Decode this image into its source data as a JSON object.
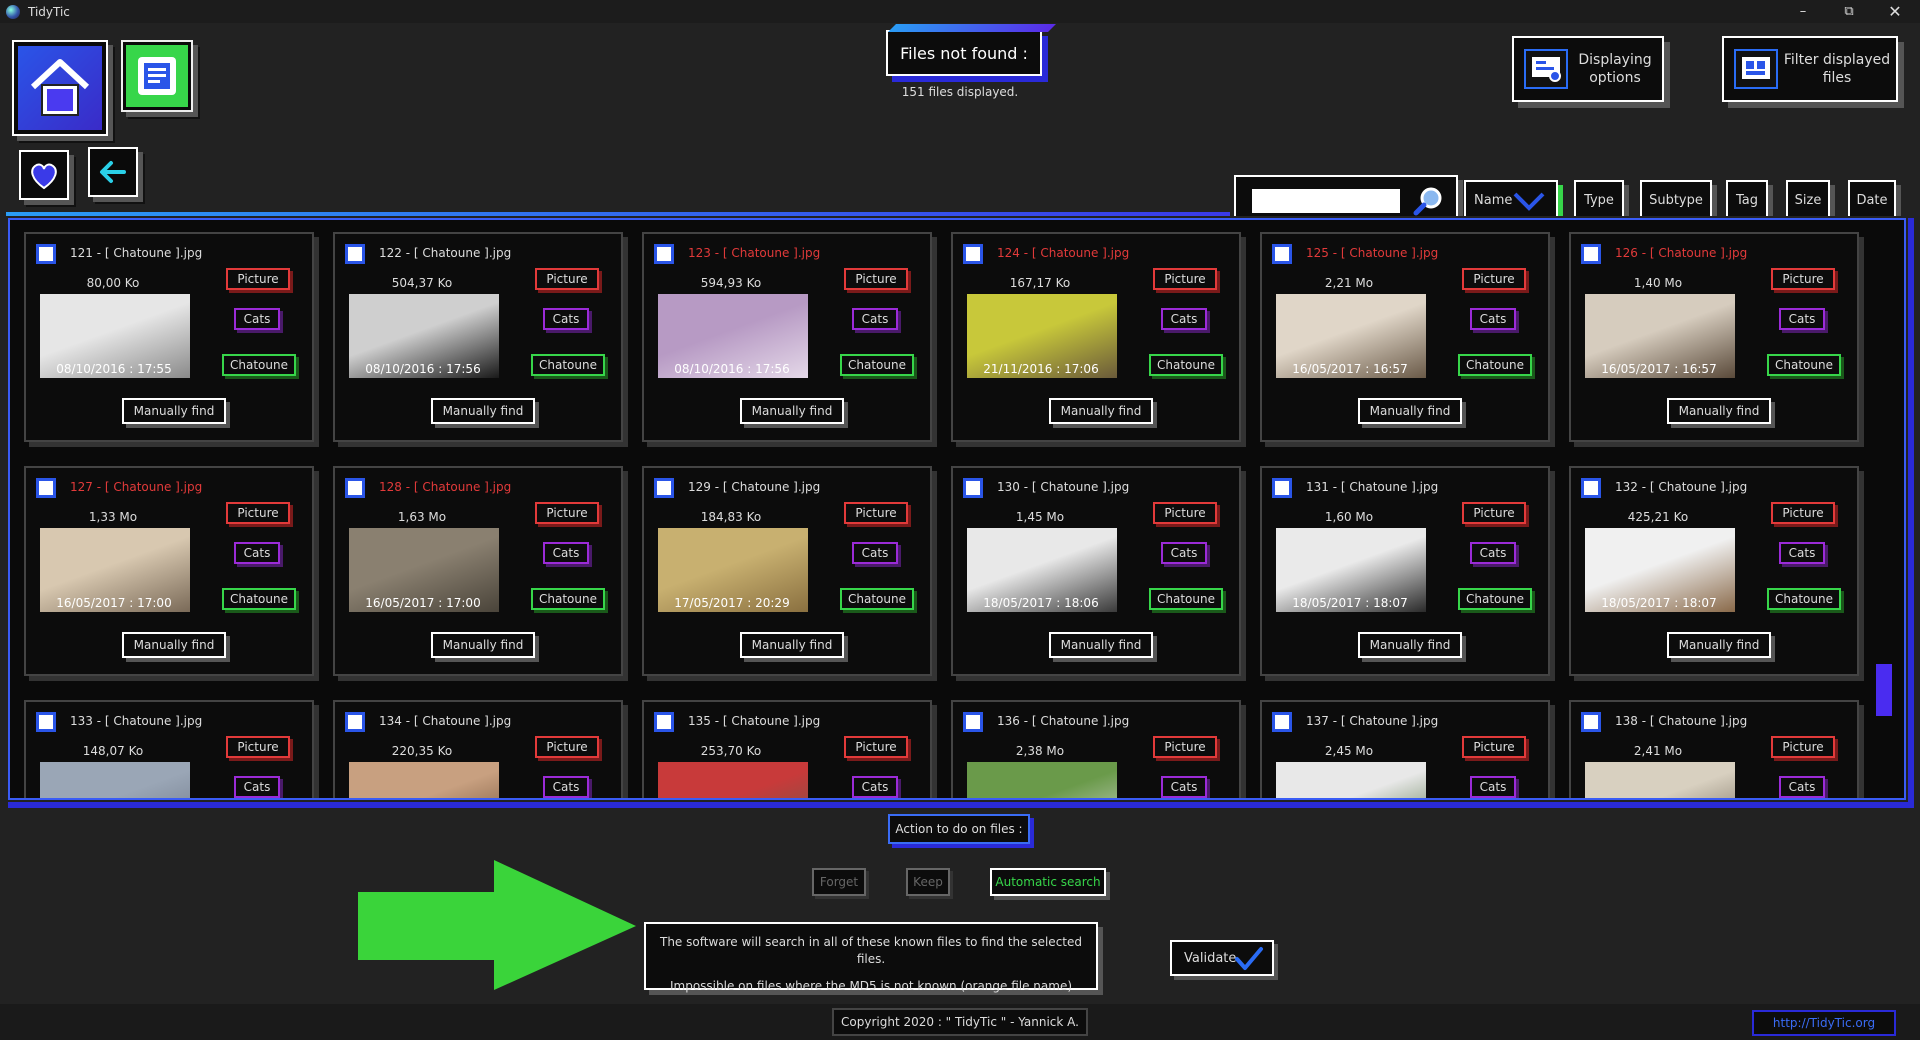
{
  "window": {
    "title": "TidyTic",
    "controls": [
      "minimize-icon",
      "restore-icon",
      "close-icon"
    ]
  },
  "header": {
    "title": "Files not found :",
    "files_count": "151 files displayed.",
    "displaying_options": "Displaying options",
    "filter_files": "Filter displayed files"
  },
  "sort": {
    "buttons": [
      "Name",
      "Type",
      "Subtype",
      "Tag",
      "Size",
      "Date"
    ],
    "active": "Name"
  },
  "colors": {
    "accent_blue": "#2a55e8",
    "green": "#37d64a",
    "red": "#e23a3a",
    "purple": "#9b2bd8",
    "panel": "#0a0a0a"
  },
  "cards": [
    {
      "name": "121 - [ Chatoune ].jpg",
      "orange": false,
      "size": "80,00 Ko",
      "date": "08/10/2016 : 17:55",
      "type": "Picture",
      "subtype": "Cats",
      "tag": "Chatoune",
      "button": "Manually find",
      "thumb": [
        "#e6e6e6",
        "#8a8a8a"
      ]
    },
    {
      "name": "122 - [ Chatoune ].jpg",
      "orange": false,
      "size": "504,37 Ko",
      "date": "08/10/2016 : 17:56",
      "type": "Picture",
      "subtype": "Cats",
      "tag": "Chatoune",
      "button": "Manually find",
      "thumb": [
        "#cfcfcf",
        "#1a1a1a"
      ]
    },
    {
      "name": "123 - [ Chatoune ].jpg",
      "orange": true,
      "size": "594,93 Ko",
      "date": "08/10/2016 : 17:56",
      "type": "Picture",
      "subtype": "Cats",
      "tag": "Chatoune",
      "button": "Manually find",
      "thumb": [
        "#b79ac4",
        "#e4d8e8"
      ]
    },
    {
      "name": "124 - [ Chatoune ].jpg",
      "orange": true,
      "size": "167,17 Ko",
      "date": "21/11/2016 : 17:06",
      "type": "Picture",
      "subtype": "Cats",
      "tag": "Chatoune",
      "button": "Manually find",
      "thumb": [
        "#c8c83a",
        "#6a5a3a"
      ]
    },
    {
      "name": "125 - [ Chatoune ].jpg",
      "orange": true,
      "size": "2,21 Mo",
      "date": "16/05/2017 : 16:57",
      "type": "Picture",
      "subtype": "Cats",
      "tag": "Chatoune",
      "button": "Manually find",
      "thumb": [
        "#e0d6c8",
        "#6a5a48"
      ]
    },
    {
      "name": "126 - [ Chatoune ].jpg",
      "orange": true,
      "size": "1,40 Mo",
      "date": "16/05/2017 : 16:57",
      "type": "Picture",
      "subtype": "Cats",
      "tag": "Chatoune",
      "button": "Manually find",
      "thumb": [
        "#d6ccbe",
        "#5a4a3a"
      ]
    },
    {
      "name": "127 - [ Chatoune ].jpg",
      "orange": true,
      "size": "1,33 Mo",
      "date": "16/05/2017 : 17:00",
      "type": "Picture",
      "subtype": "Cats",
      "tag": "Chatoune",
      "button": "Manually find",
      "thumb": [
        "#d8c8b0",
        "#7a6a58"
      ]
    },
    {
      "name": "128 - [ Chatoune ].jpg",
      "orange": true,
      "size": "1,63 Mo",
      "date": "16/05/2017 : 17:00",
      "type": "Picture",
      "subtype": "Cats",
      "tag": "Chatoune",
      "button": "Manually find",
      "thumb": [
        "#8a8070",
        "#4a443a"
      ]
    },
    {
      "name": "129 - [ Chatoune ].jpg",
      "orange": false,
      "size": "184,83 Ko",
      "date": "17/05/2017 : 20:29",
      "type": "Picture",
      "subtype": "Cats",
      "tag": "Chatoune",
      "button": "Manually find",
      "thumb": [
        "#c8b070",
        "#8a7040"
      ]
    },
    {
      "name": "130 - [ Chatoune ].jpg",
      "orange": false,
      "size": "1,45 Mo",
      "date": "18/05/2017 : 18:06",
      "type": "Picture",
      "subtype": "Cats",
      "tag": "Chatoune",
      "button": "Manually find",
      "thumb": [
        "#e8e8e8",
        "#3a3a3a"
      ]
    },
    {
      "name": "131 - [ Chatoune ].jpg",
      "orange": false,
      "size": "1,60 Mo",
      "date": "18/05/2017 : 18:07",
      "type": "Picture",
      "subtype": "Cats",
      "tag": "Chatoune",
      "button": "Manually find",
      "thumb": [
        "#eaeaea",
        "#2a2a2a"
      ]
    },
    {
      "name": "132 - [ Chatoune ].jpg",
      "orange": false,
      "size": "425,21 Ko",
      "date": "18/05/2017 : 18:07",
      "type": "Picture",
      "subtype": "Cats",
      "tag": "Chatoune",
      "button": "Manually find",
      "thumb": [
        "#f0f0f0",
        "#8a6a4a"
      ]
    },
    {
      "name": "133 - [ Chatoune ].jpg",
      "orange": false,
      "size": "148,07 Ko",
      "date": "",
      "type": "Picture",
      "subtype": "Cats",
      "tag": "",
      "button": "",
      "thumb": [
        "#9aa6b6",
        "#6a7484"
      ]
    },
    {
      "name": "134 - [ Chatoune ].jpg",
      "orange": false,
      "size": "220,35 Ko",
      "date": "",
      "type": "Picture",
      "subtype": "Cats",
      "tag": "",
      "button": "",
      "thumb": [
        "#c8a080",
        "#6a4a30"
      ]
    },
    {
      "name": "135 - [ Chatoune ].jpg",
      "orange": false,
      "size": "253,70 Ko",
      "date": "",
      "type": "Picture",
      "subtype": "Cats",
      "tag": "",
      "button": "",
      "thumb": [
        "#c83a3a",
        "#6a5a4a"
      ]
    },
    {
      "name": "136 - [ Chatoune ].jpg",
      "orange": false,
      "size": "2,38 Mo",
      "date": "",
      "type": "Picture",
      "subtype": "Cats",
      "tag": "",
      "button": "",
      "thumb": [
        "#6a9a4a",
        "#d8d8d8"
      ]
    },
    {
      "name": "137 - [ Chatoune ].jpg",
      "orange": false,
      "size": "2,45 Mo",
      "date": "",
      "type": "Picture",
      "subtype": "Cats",
      "tag": "",
      "button": "",
      "thumb": [
        "#e8e8e8",
        "#4a6a3a"
      ]
    },
    {
      "name": "138 - [ Chatoune ].jpg",
      "orange": false,
      "size": "2,41 Mo",
      "date": "",
      "type": "Picture",
      "subtype": "Cats",
      "tag": "",
      "button": "",
      "thumb": [
        "#d8d0c0",
        "#6a6050"
      ]
    }
  ],
  "actions": {
    "label": "Action to do on files :",
    "forget": "Forget",
    "keep": "Keep",
    "automatic": "Automatic search",
    "info_line1": "The software will search in all of these known files to find the selected files.",
    "info_line2": "Impossible on files where the MD5 is not known (orange file name)",
    "validate": "Validate"
  },
  "footer": {
    "copyright": "Copyright 2020 : \" TidyTic \" - Yannick A.",
    "link": "http://TidyTic.org"
  }
}
